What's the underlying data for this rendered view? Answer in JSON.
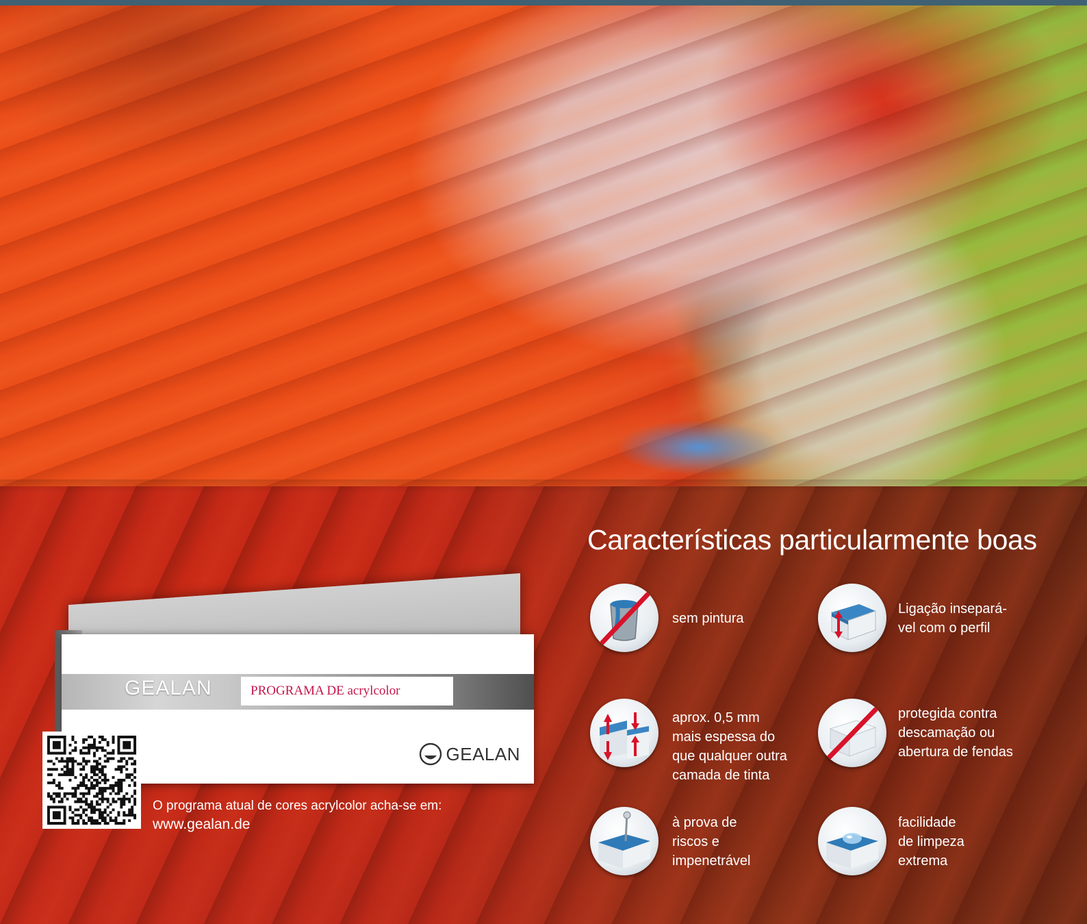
{
  "brochure": {
    "brand": "GEALAN",
    "label": "PROGRAMA DE acrylcolor",
    "logo_text": "GEALAN"
  },
  "program_info": {
    "text": "O programa atual de cores acrylcolor acha-se em:",
    "url": "www.gealan.de"
  },
  "features": {
    "title": "Características particularmente boas",
    "items": [
      {
        "icon": "no-paint-icon",
        "lines": [
          "sem pintura"
        ]
      },
      {
        "icon": "bond-icon",
        "lines": [
          "Ligação insepará-",
          "vel com o perfil"
        ]
      },
      {
        "icon": "thickness-icon",
        "lines": [
          "aprox. 0,5 mm",
          "mais espessa do",
          "que qualquer outra",
          "camada de tinta"
        ]
      },
      {
        "icon": "no-flaking-icon",
        "lines": [
          "protegida contra",
          "descamação ou",
          "abertura de fendas"
        ]
      },
      {
        "icon": "scratch-proof-icon",
        "lines": [
          "à prova de",
          "riscos e",
          "impenetrável"
        ]
      },
      {
        "icon": "easy-clean-icon",
        "lines": [
          "facilidade",
          "de limpeza",
          "extrema"
        ]
      }
    ]
  },
  "colors": {
    "label_red": "#c5164d",
    "top_strip": "#3f6173",
    "icon_arrow_red": "#d8122a",
    "icon_blue": "#2f7bb8"
  }
}
